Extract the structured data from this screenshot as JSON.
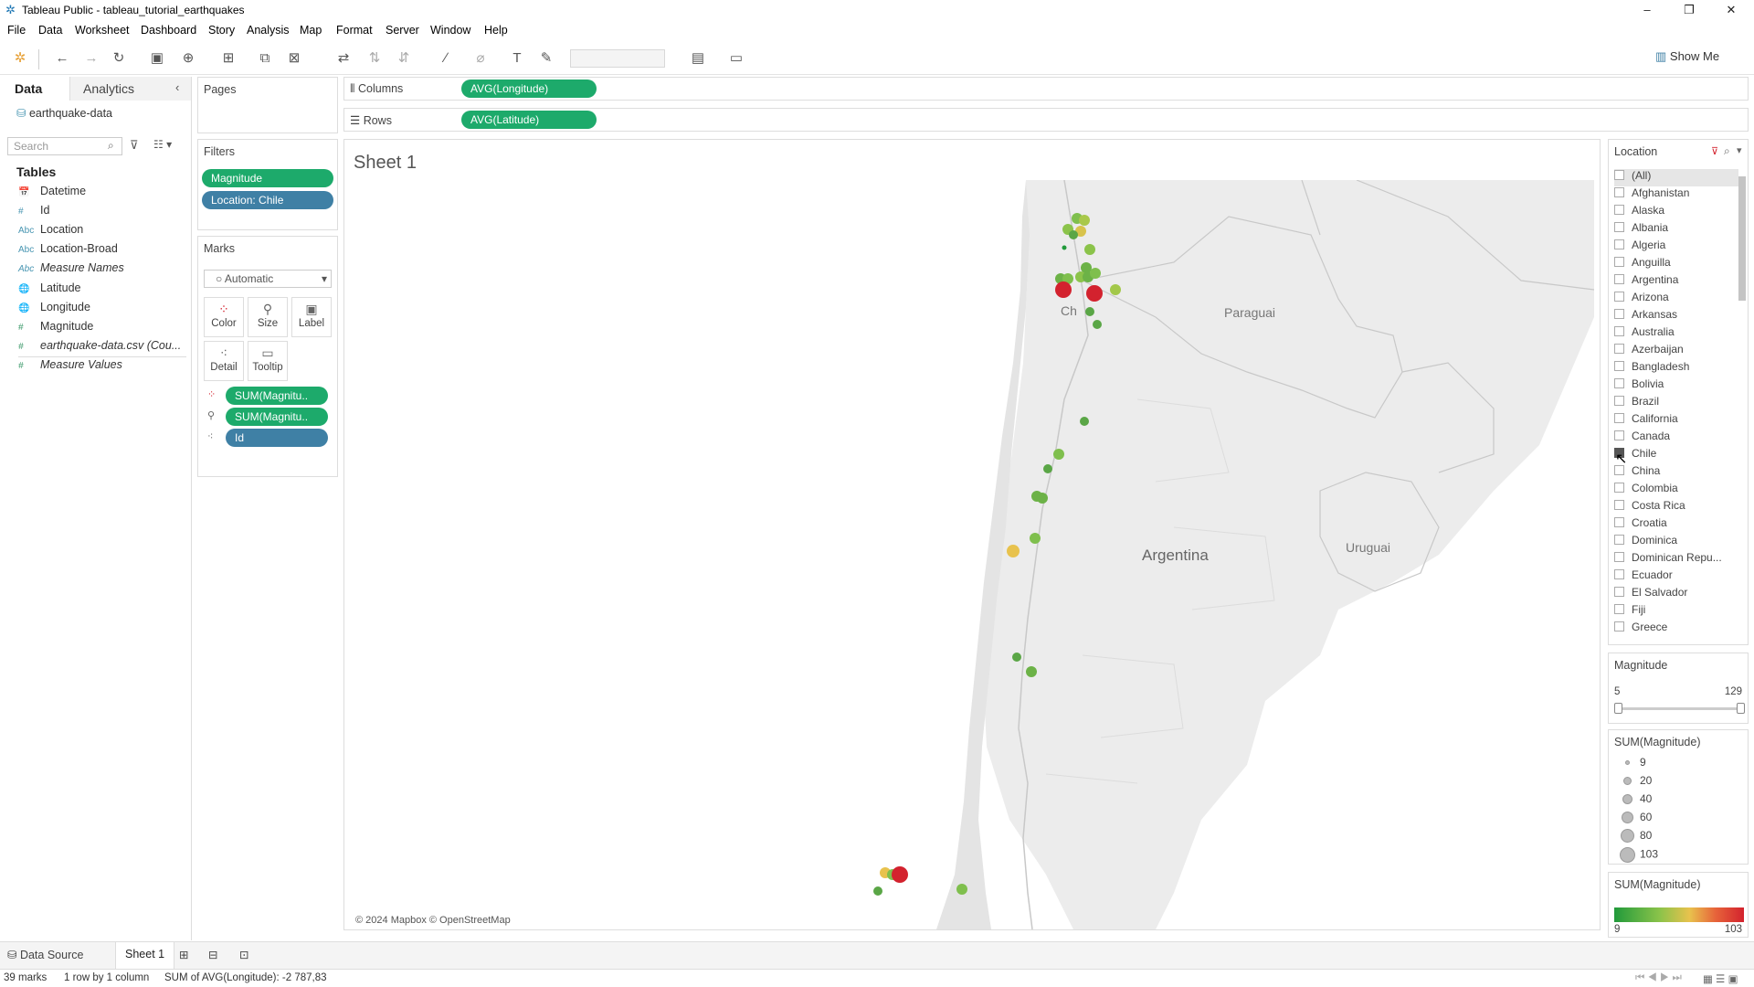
{
  "window": {
    "title": "Tableau Public - tableau_tutorial_earthquakes"
  },
  "menu": [
    "File",
    "Data",
    "Worksheet",
    "Dashboard",
    "Story",
    "Analysis",
    "Map",
    "Format",
    "Server",
    "Window",
    "Help"
  ],
  "toolbar": {
    "show_me": "Show Me"
  },
  "data_pane": {
    "tab_data": "Data",
    "tab_analytics": "Analytics",
    "datasource": "earthquake-data",
    "search_placeholder": "Search",
    "tables_header": "Tables",
    "fields": [
      {
        "name": "Datetime",
        "type": "date"
      },
      {
        "name": "Id",
        "type": "measure"
      },
      {
        "name": "Location",
        "type": "string"
      },
      {
        "name": "Location-Broad",
        "type": "string"
      },
      {
        "name": "Measure Names",
        "type": "string"
      },
      {
        "name": "Latitude",
        "type": "geo"
      },
      {
        "name": "Longitude",
        "type": "geo"
      },
      {
        "name": "Magnitude",
        "type": "measure"
      },
      {
        "name": "earthquake-data.csv (Cou...",
        "type": "measure"
      },
      {
        "name": "Measure Values",
        "type": "measure"
      }
    ]
  },
  "pages": {
    "label": "Pages"
  },
  "filters": {
    "label": "Filters",
    "pills": [
      "Magnitude",
      "Location: Chile"
    ]
  },
  "marks": {
    "label": "Marks",
    "type": "Automatic",
    "buttons": [
      "Color",
      "Size",
      "Label",
      "Detail",
      "Tooltip"
    ],
    "pills": [
      "SUM(Magnitu..",
      "SUM(Magnitu..",
      "Id"
    ]
  },
  "shelves": {
    "columns_label": "Columns",
    "columns_pill": "AVG(Longitude)",
    "rows_label": "Rows",
    "rows_pill": "AVG(Latitude)"
  },
  "sheet": {
    "title": "Sheet 1",
    "credit": "© 2024 Mapbox © OpenStreetMap"
  },
  "map_labels": [
    "Paraguai",
    "Argentina",
    "Uruguai",
    "Ch"
  ],
  "location_legend": {
    "label": "Location",
    "items": [
      "(All)",
      "Afghanistan",
      "Alaska",
      "Albania",
      "Algeria",
      "Anguilla",
      "Argentina",
      "Arizona",
      "Arkansas",
      "Australia",
      "Azerbaijan",
      "Bangladesh",
      "Bolivia",
      "Brazil",
      "California",
      "Canada",
      "Chile",
      "China",
      "Colombia",
      "Costa Rica",
      "Croatia",
      "Dominica",
      "Dominican Repu...",
      "Ecuador",
      "El Salvador",
      "Fiji",
      "Greece"
    ],
    "checked": "Chile"
  },
  "magnitude_filter": {
    "label": "Magnitude",
    "min": "5",
    "max": "129"
  },
  "size_legend": {
    "label": "SUM(Magnitude)",
    "values": [
      "9",
      "20",
      "40",
      "60",
      "80",
      "103"
    ]
  },
  "color_legend": {
    "label": "SUM(Magnitude)",
    "min": "9",
    "max": "103"
  },
  "colors": {
    "green_pill": "#1daa6b",
    "blue_pill": "#3f80a5",
    "low": "#219a3b",
    "mid": "#e8c24d",
    "high": "#d3222e"
  },
  "bottom_tabs": {
    "data_source": "Data Source",
    "sheet1": "Sheet 1"
  },
  "status": {
    "marks": "39 marks",
    "dims": "1 row by 1 column",
    "sum": "SUM of AVG(Longitude): -2 787,83"
  }
}
